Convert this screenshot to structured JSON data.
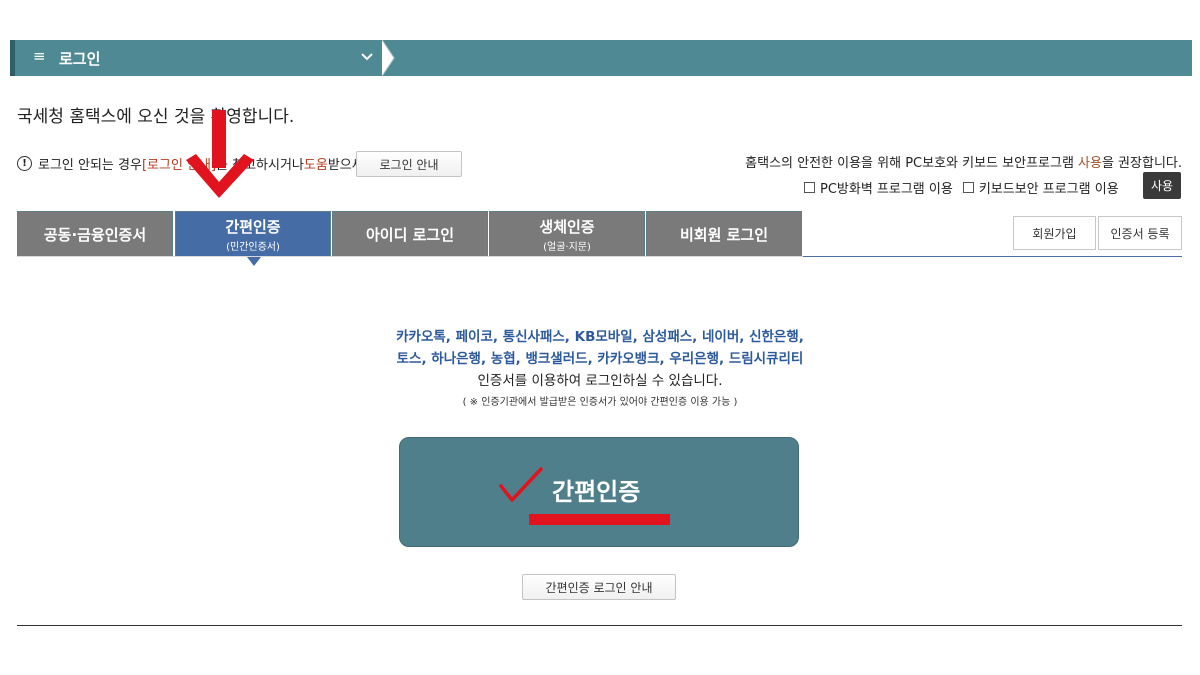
{
  "menubar": {
    "title": "로그인",
    "menu_icon": "≡",
    "chevron": "chevron-down-icon"
  },
  "welcome": "국세청 홈택스에 오신 것을 환영합니다.",
  "notice": {
    "icon": "!",
    "prefix": "로그인 안되는 경우 ",
    "link1": "[로그인 안내]",
    "middle": "를 참고하시거나 ",
    "link2": "도움",
    "suffix": "받으세요.",
    "guide_button": "로그인 안내"
  },
  "security": {
    "text_prefix": "홈택스의 안전한 이용을 위해 PC보호와 키보드 보안프로그램 ",
    "text_highlight": "사용",
    "text_suffix": "을 권장합니다.",
    "option1": "PC방화벽 프로그램 이용",
    "option2": "키보드보안 프로그램 이용",
    "use_button": "사용"
  },
  "tabs": [
    {
      "label": "공동·금융인증서",
      "sub": ""
    },
    {
      "label": "간편인증",
      "sub": "(민간인증서)"
    },
    {
      "label": "아이디 로그인",
      "sub": ""
    },
    {
      "label": "생체인증",
      "sub": "(얼굴·지문)"
    },
    {
      "label": "비회원 로그인",
      "sub": ""
    }
  ],
  "side_buttons": {
    "signup": "회원가입",
    "register_cert": "인증서 등록"
  },
  "description": {
    "line1": "카카오톡, 페이코, 통신사패스, KB모바일, 삼성패스, 네이버, 신한은행,",
    "line2": "토스, 하나은행, 농협, 뱅크샐러드, 카카오뱅크, 우리은행, 드림시큐리티",
    "line3": "인증서를 이용하여 로그인하실 수 있습니다.",
    "line4": "( ※ 인증기관에서 발급받은 인증서가 있어야 간편인증 이용 가능 )"
  },
  "main_button": "간편인증",
  "guide_button2": "간편인증 로그인 안내",
  "colors": {
    "menubar": "#4f8a94",
    "active_tab": "#466ca6",
    "inactive_tab": "#7a7a7a",
    "main_button": "#4f7f8a",
    "annotation_red": "#e0131e",
    "link_blue": "#2d5a9c"
  }
}
